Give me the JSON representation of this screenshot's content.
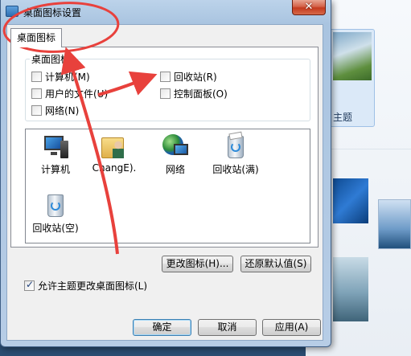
{
  "background_window": {
    "theme_label": "主题"
  },
  "dialog": {
    "title": "桌面图标设置",
    "close_glyph": "✕",
    "tab_label": "桌面图标",
    "group_label": "桌面图标",
    "checkboxes": {
      "computer": {
        "label": "计算机(M)",
        "checked": false
      },
      "user_files": {
        "label": "用户的文件(U)",
        "checked": false
      },
      "network": {
        "label": "网络(N)",
        "checked": false
      },
      "recycle_bin": {
        "label": "回收站(R)",
        "checked": false
      },
      "control_panel": {
        "label": "控制面板(O)",
        "checked": false
      }
    },
    "icons": [
      {
        "icon": "computer-icon",
        "label": "计算机"
      },
      {
        "icon": "user-folder-icon",
        "label": "ChangE)."
      },
      {
        "icon": "network-icon",
        "label": "网络"
      },
      {
        "icon": "recycle-bin-full-icon",
        "label": "回收站(满)"
      },
      {
        "icon": "recycle-bin-empty-icon",
        "label": "回收站(空)"
      }
    ],
    "change_icon_button": "更改图标(H)...",
    "restore_default_button": "还原默认值(S)",
    "allow_themes_checkbox": {
      "label": "允许主题更改桌面图标(L)",
      "checked": true
    },
    "ok_button": "确定",
    "cancel_button": "取消",
    "apply_button": "应用(A)"
  },
  "colors": {
    "annotation_red": "#e8413c",
    "title_bar": "#bcd3ea",
    "close_button": "#c43a1e",
    "default_button_border": "#3c7fb1"
  }
}
